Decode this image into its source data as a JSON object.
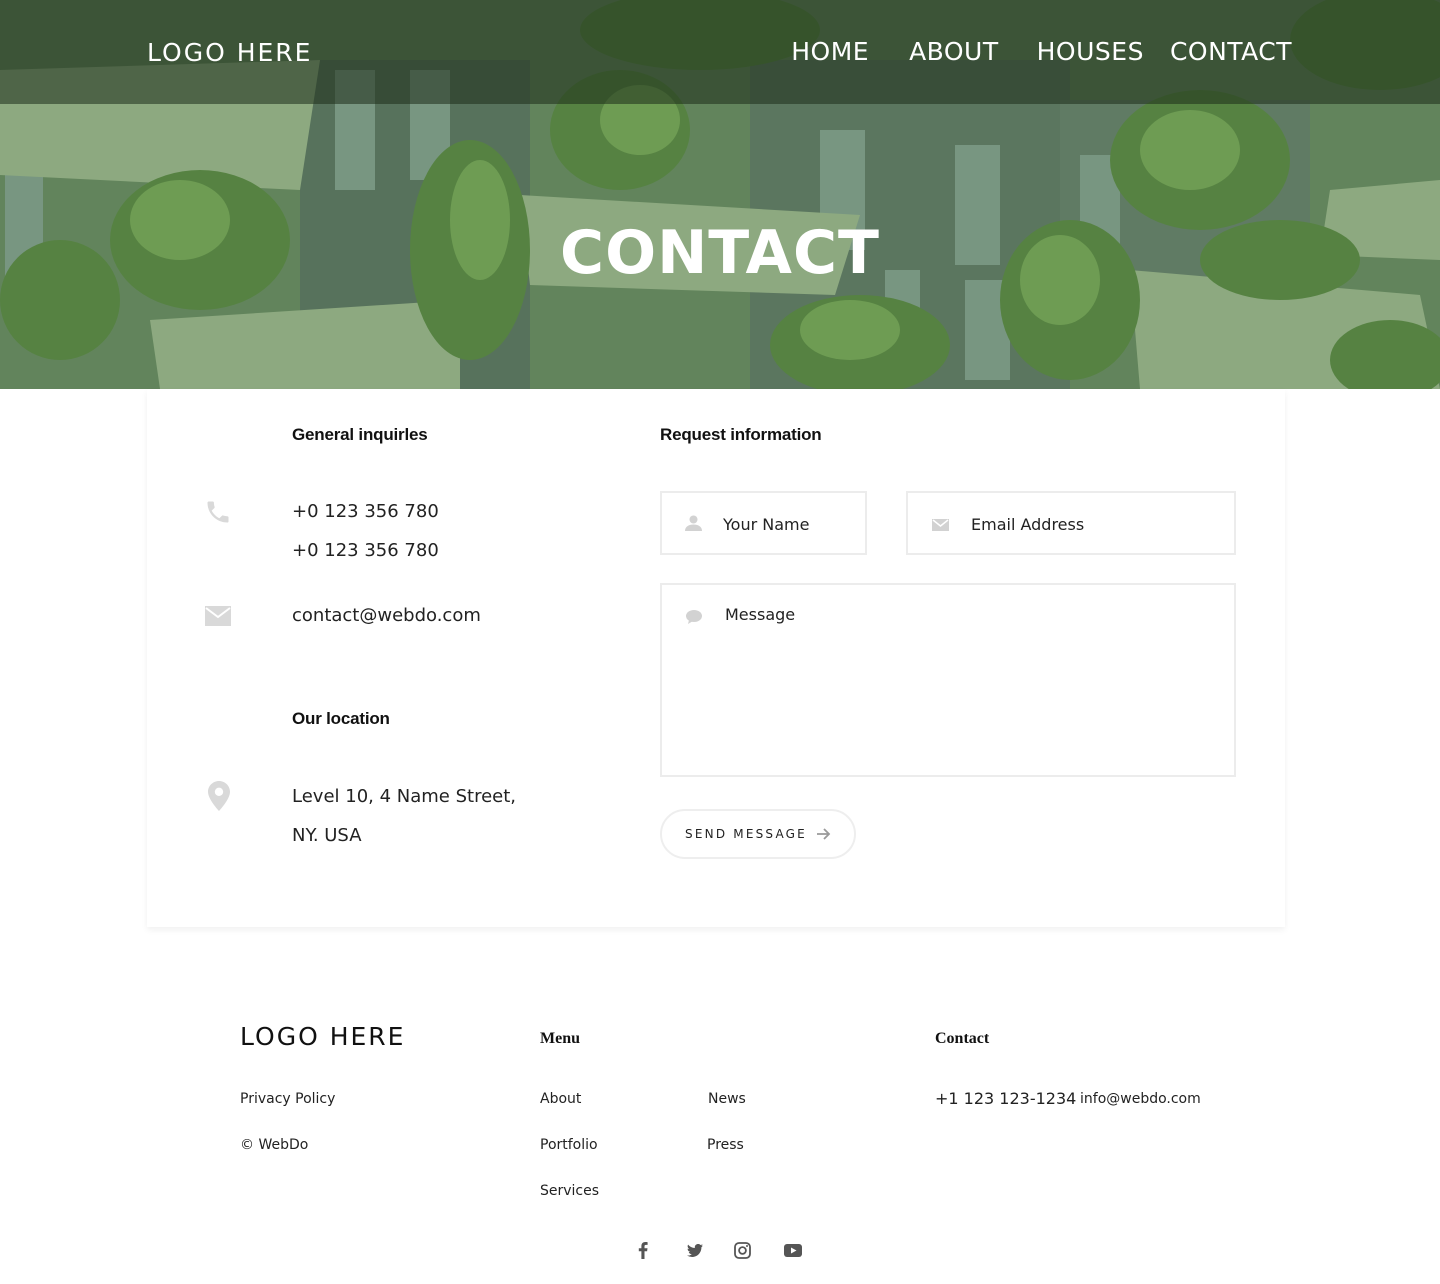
{
  "header": {
    "logo": "LOGO HERE",
    "nav": [
      "HOME",
      "ABOUT",
      "HOUSES",
      "CONTACT"
    ]
  },
  "hero": {
    "title": "CONTACT"
  },
  "contact_info": {
    "general_heading": "General inquirles",
    "phone_1": "+0 123 356 780",
    "phone_2": "+0 123 356 780",
    "email": "contact@webdo.com",
    "location_heading": "Our location",
    "address_line_1": "Level 10, 4 Name Street,",
    "address_line_2": "NY. USA",
    "icons": [
      "phone-icon",
      "mail-icon",
      "map-pin-icon"
    ]
  },
  "form": {
    "heading": "Request information",
    "name_placeholder": "Your Name",
    "email_placeholder": "Email Address",
    "message_placeholder": "Message",
    "send_label": "SEND MESSAGE",
    "icons": [
      "user-icon",
      "envelope-icon",
      "chat-bubble-icon",
      "arrow-right-icon"
    ]
  },
  "footer": {
    "logo": "LOGO HERE",
    "privacy": "Privacy Policy",
    "copyright": "© WebDo",
    "menu_heading": "Menu",
    "menu_left": [
      "About",
      "Portfolio",
      "Services"
    ],
    "menu_right": [
      "News",
      "Press"
    ],
    "contact_heading": "Contact",
    "phone": "+1 123 123-1234",
    "email": "info@webdo.com",
    "social": [
      "facebook-icon",
      "twitter-icon",
      "instagram-icon",
      "youtube-icon"
    ]
  },
  "colors": {
    "overlay": "#3a5a30",
    "text": "#111111",
    "icon_gray": "#d6d6d6"
  }
}
